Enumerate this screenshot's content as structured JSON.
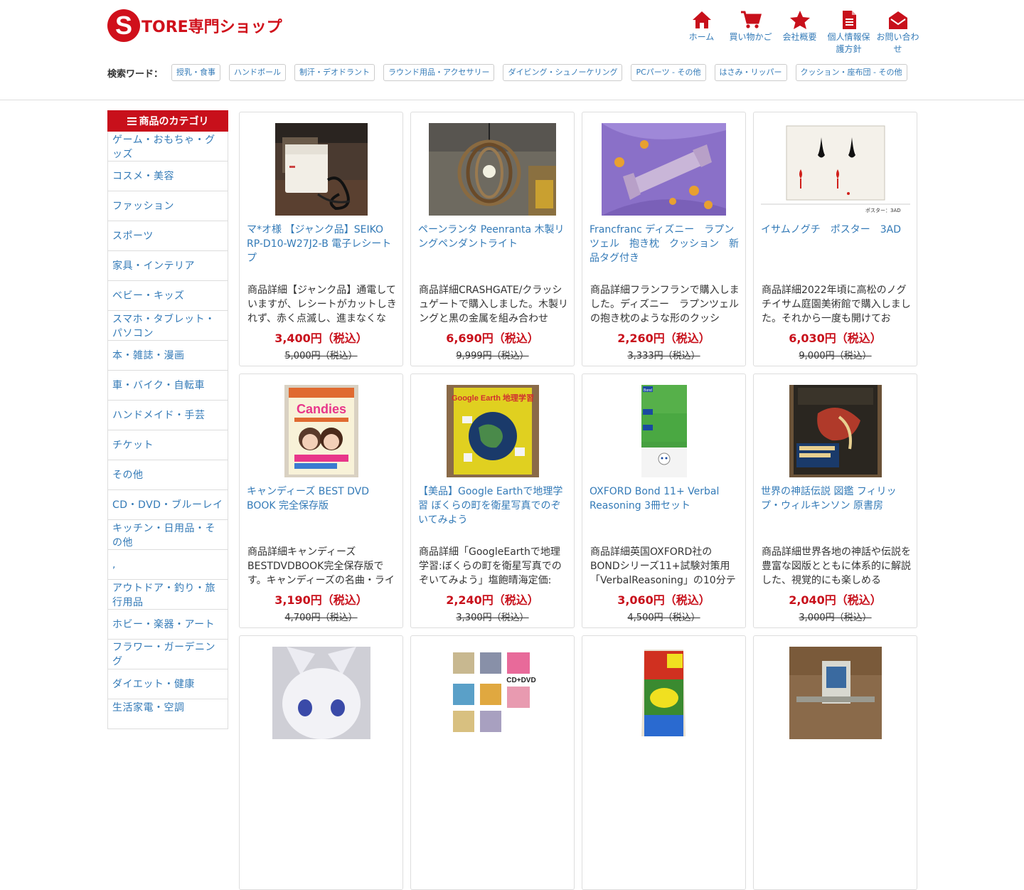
{
  "logo": {
    "initial": "S",
    "text": "TORE専門ショップ"
  },
  "nav": [
    {
      "label": "ホーム",
      "icon": "home-icon"
    },
    {
      "label": "買い物かご",
      "icon": "cart-icon"
    },
    {
      "label": "会社概要",
      "icon": "star-icon"
    },
    {
      "label": "個人情報保護方針",
      "icon": "document-icon"
    },
    {
      "label": "お問い合わせ",
      "icon": "envelope-icon"
    }
  ],
  "search": {
    "label": "検索ワード：",
    "tags": [
      "授乳・食事",
      "ハンドボール",
      "制汗・デオドラント",
      "ラウンド用品・アクセサリー",
      "ダイビング・シュノーケリング",
      "PCパーツ - その他",
      "はさみ・リッパー",
      "クッション・座布団 - その他"
    ]
  },
  "sidebar": {
    "header": "商品のカテゴリ",
    "items": [
      "ゲーム・おもちゃ・グッズ",
      "コスメ・美容",
      "ファッション",
      "スポーツ",
      "家具・インテリア",
      "ベビー・キッズ",
      "スマホ・タブレット・パソコン",
      "本・雑誌・漫画",
      "車・バイク・自転車",
      "ハンドメイド・手芸",
      "チケット",
      "その他",
      "CD・DVD・ブルーレイ",
      "キッチン・日用品・その他",
      ",",
      "アウトドア・釣り・旅行用品",
      "ホビー・楽器・アート",
      "フラワー・ガーデニング",
      "ダイエット・健康",
      "生活家電・空調"
    ]
  },
  "products": [
    {
      "title": "マ*オ様 【ジャンク品】SEIKO RP-D10-W27J2-B 電子レシートプ",
      "desc": "商品詳細【ジャンク品】通電していますが、レシートがカットしきれず、赤く点滅し、進まなくな",
      "price": "3,400円（税込）",
      "orig": "5,000円（税込）",
      "image": "receipt-printer-photo"
    },
    {
      "title": "ペーンランタ Peenranta 木製リングペンダントライト",
      "desc": "商品詳細CRASHGATE/クラッシュゲートで購入しました。木製リングと黒の金属を組み合わせ",
      "price": "6,690円（税込）",
      "orig": "9,999円（税込）",
      "image": "pendant-light-photo"
    },
    {
      "title": "Francfranc ディズニー　ラプンツェル　抱き枕　クッション　新品タグ付き",
      "desc": "商品詳細フランフランで購入しました。ディズニー　ラプンツェルの抱き枕のような形のクッシ",
      "price": "2,260円（税込）",
      "orig": "3,333円（税込）",
      "image": "cushion-photo"
    },
    {
      "title": "イサムノグチ　ポスター　3AD",
      "desc": "商品詳細2022年頃に高松のノグチイサム庭園美術館で購入しました。それから一度も開けてお",
      "price": "6,030円（税込）",
      "orig": "9,000円（税込）",
      "image": "poster-photo",
      "caption": "ポスター：3AD"
    },
    {
      "title": "キャンディーズ BEST DVD BOOK 完全保存版",
      "desc": "商品詳細キャンディーズBESTDVDBOOK完全保存版です。キャンディーズの名曲・ライ",
      "price": "3,190円（税込）",
      "orig": "4,700円（税込）",
      "image": "dvd-book-photo",
      "cover_text": "Candies"
    },
    {
      "title": "【美品】Google Earthで地理学習 ぼくらの町を衛星写真でのぞいてみよう",
      "desc": "商品詳細「GoogleEarthで地理学習:ぼくらの町を衛星写真でのぞいてみよう」塩飽晴海定価:",
      "price": "2,240円（税込）",
      "orig": "3,300円（税込）",
      "image": "book-google-earth-photo",
      "cover_text": "Google Earth 地理学習"
    },
    {
      "title": "OXFORD Bond 11+ Verbal Reasoning 3冊セット",
      "desc": "商品詳細英国OXFORD社のBONDシリーズ11+試験対策用「VerbalReasoning」の10分テス",
      "price": "3,060円（税込）",
      "orig": "4,500円（税込）",
      "image": "bond-books-photo",
      "cover_text": "Bond"
    },
    {
      "title": "世界の神話伝説 図鑑 フィリップ・ウィルキンソン 原書房",
      "desc": "商品詳細世界各地の神話や伝説を豊富な図版とともに体系的に解説した、視覚的にも楽しめる",
      "price": "2,040円（税込）",
      "orig": "3,000円（税込）",
      "image": "mythology-book-photo"
    },
    {
      "title": "",
      "desc": "",
      "price": "",
      "orig": "",
      "image": "plush-photo"
    },
    {
      "title": "",
      "desc": "",
      "price": "",
      "orig": "",
      "image": "cd-dvd-set-photo",
      "cover_text": "CD+DVD"
    },
    {
      "title": "",
      "desc": "",
      "price": "",
      "orig": "",
      "image": "mole-trap-photo"
    },
    {
      "title": "",
      "desc": "",
      "price": "",
      "orig": "",
      "image": "device-photo"
    }
  ],
  "colors": {
    "brand_red": "#c8101b",
    "link_blue": "#337ab7"
  }
}
